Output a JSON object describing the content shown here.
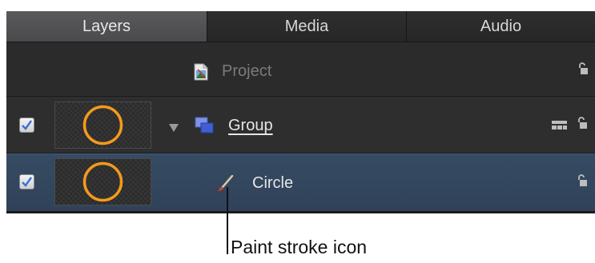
{
  "tabs": [
    {
      "label": "Layers",
      "active": true
    },
    {
      "label": "Media",
      "active": false
    },
    {
      "label": "Audio",
      "active": false
    }
  ],
  "rows": {
    "project": {
      "label": "Project",
      "icon": "project-file-icon",
      "lock_icon": "lock-icon"
    },
    "group": {
      "label": "Group",
      "checked": true,
      "icon": "group-layers-icon",
      "disclosure": "disclosure-triangle-open",
      "extra_icons": [
        "layer-stack-icon",
        "lock-icon"
      ]
    },
    "circle": {
      "label": "Circle",
      "checked": true,
      "icon": "paint-stroke-icon",
      "lock_icon": "lock-icon",
      "selected": true
    }
  },
  "callout": {
    "text": "Paint stroke icon"
  },
  "colors": {
    "panel_bg": "#2a2a2b",
    "selected_row": "#33475e",
    "thumb_ring": "#f39a1d",
    "checkbox_check": "#3b6fd6",
    "group_icon": "#4f6fd8"
  }
}
